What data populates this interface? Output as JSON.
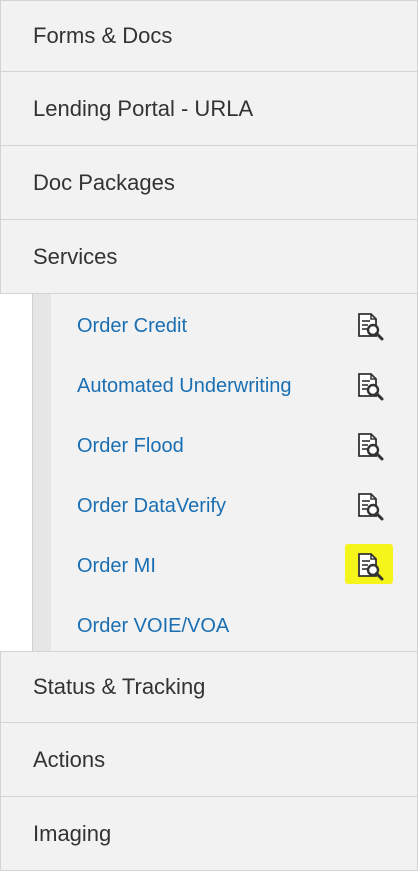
{
  "sections": [
    {
      "label": "Forms & Docs"
    },
    {
      "label": "Lending Portal - URLA"
    },
    {
      "label": "Doc Packages"
    },
    {
      "label": "Services"
    }
  ],
  "services_items": [
    {
      "label": "Order Credit",
      "icon": "document-search-icon"
    },
    {
      "label": "Automated Underwriting",
      "icon": "document-search-icon"
    },
    {
      "label": "Order Flood",
      "icon": "document-search-icon"
    },
    {
      "label": "Order DataVerify",
      "icon": "document-search-icon"
    },
    {
      "label": "Order MI",
      "icon": "document-search-icon",
      "highlight": "#f6f51b"
    },
    {
      "label": "Order VOIE/VOA"
    }
  ],
  "bottom_sections": [
    {
      "label": "Status & Tracking"
    },
    {
      "label": "Actions"
    },
    {
      "label": "Imaging"
    }
  ],
  "colors": {
    "section_bg": "#f2f2f2",
    "border": "#d3d3d3",
    "link": "#1a6fb3",
    "highlight": "#f6f51b"
  }
}
